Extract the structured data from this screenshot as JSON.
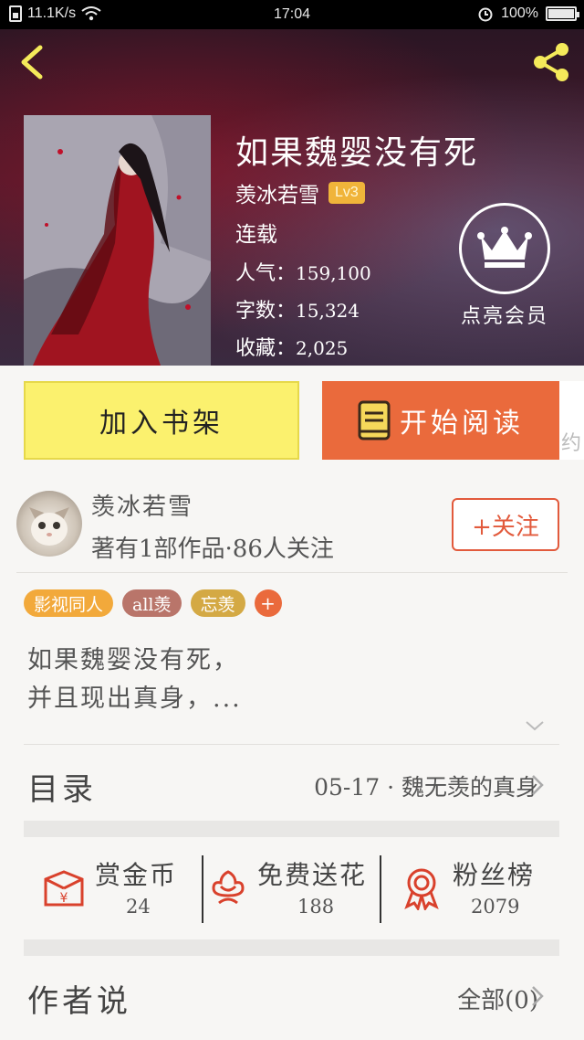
{
  "status_bar": {
    "network_speed": "11.1K/s",
    "time": "17:04",
    "battery": "100%"
  },
  "book": {
    "title": "如果魏婴没有死",
    "author": "羡冰若雪",
    "level": "Lv3",
    "status": "连载",
    "popularity_label": "人气：",
    "popularity": "159,100",
    "words_label": "字数：",
    "words": "15,324",
    "favorites_label": "收藏：",
    "favorites": "2,025"
  },
  "vip": {
    "label": "点亮会员"
  },
  "actions": {
    "add_shelf": "加入书架",
    "start_read": "开始阅读",
    "peek_text": "约"
  },
  "author_card": {
    "name": "羡冰若雪",
    "meta": "著有1部作品·86人关注",
    "follow": "+关注"
  },
  "tags": [
    {
      "label": "影视同人",
      "color": "#f2a93b"
    },
    {
      "label": "all羡",
      "color": "#b9756a"
    },
    {
      "label": "忘羡",
      "color": "#d4a944"
    }
  ],
  "tag_add": "+",
  "description": {
    "line1": "如果魏婴没有死，",
    "line2": "并且现出真身，..."
  },
  "toc": {
    "label": "目录",
    "latest": "05-17 · 魏无羡的真身"
  },
  "stats": {
    "coins_label": "赏金币",
    "coins": "24",
    "flowers_label": "免费送花",
    "flowers": "188",
    "fans_label": "粉丝榜",
    "fans": "2079"
  },
  "author_says": {
    "label": "作者说",
    "all": "全部(0)"
  },
  "colors": {
    "accent": "#ea6a3c",
    "shelf_button": "#fbf16e",
    "icon_red": "#d9412c"
  }
}
